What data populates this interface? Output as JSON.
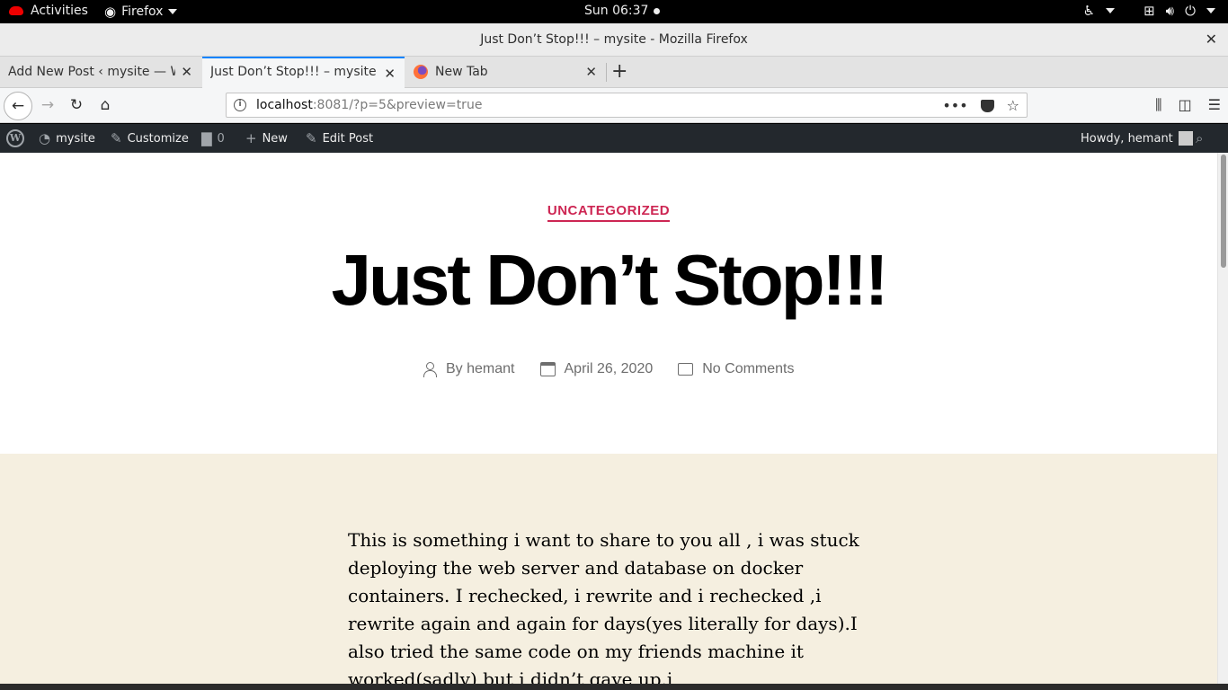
{
  "gnome": {
    "activities": "Activities",
    "app_name": "Firefox",
    "clock": "Sun 06:37"
  },
  "window": {
    "title": "Just Don’t Stop!!! – mysite - Mozilla Firefox",
    "close_glyph": "✕"
  },
  "tabs": [
    {
      "label": "Add New Post ‹ mysite — WordPress"
    },
    {
      "label": "Just Don’t Stop!!! – mysite"
    },
    {
      "label": "New Tab"
    }
  ],
  "urlbar": {
    "host": "localhost",
    "rest": ":8081/?p=5&preview=true"
  },
  "wp_admin_bar": {
    "site": "mysite",
    "customize": "Customize",
    "comments_count": "0",
    "new": "New",
    "edit_post": "Edit Post",
    "howdy": "Howdy, hemant"
  },
  "post": {
    "category": "UNCATEGORIZED",
    "title": "Just Don’t Stop!!!",
    "author_prefix": "By",
    "author": "hemant",
    "date": "April 26, 2020",
    "comments": "No Comments",
    "body": "This is something i want to share to you all , i was stuck deploying the web server and database on docker containers. I rechecked, i rewrite and i rechecked ,i rewrite again and again for days(yes literally for days).I also tried the same code on my friends machine it worked(sadly) but i didn’t gave up.i"
  },
  "colors": {
    "accent": "#cd2653",
    "content_bg": "#f5efe0",
    "wp_bar": "#23282d",
    "tab_active_border": "#0a84ff"
  }
}
